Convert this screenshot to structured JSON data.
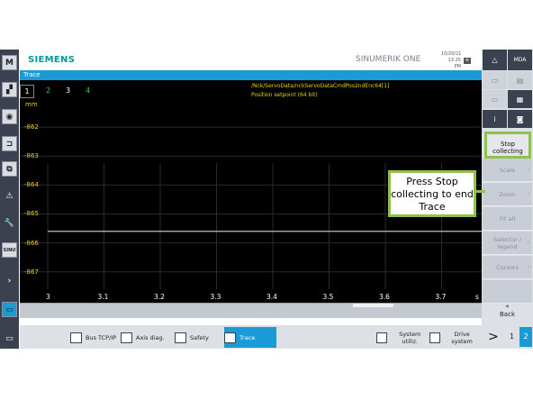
{
  "header": {
    "brand": "SIEMENS",
    "product": "SINUMERIK ONE",
    "date": "10/20/21",
    "time": "13:25 PM",
    "badge": "≡"
  },
  "window": {
    "title": "Trace"
  },
  "trace": {
    "tabs": [
      "1",
      "2",
      "3",
      "4"
    ],
    "tab_colors": [
      "#ffffff",
      "#3fc858",
      "#ffffff",
      "#3fc858"
    ],
    "unit": "mm",
    "signal_path": "/Nck/ServoData/nckServoDataCmdPos2ndEnc64[1]",
    "signal_name": "Position setpoint (64 bit)",
    "line_color": "#e8d200",
    "trace_color": "#bfbfbf"
  },
  "chart_data": {
    "type": "line",
    "x_ticks": [
      "3",
      "3.1",
      "3.2",
      "3.3",
      "3.4",
      "3.5",
      "3.6",
      "3.7"
    ],
    "x_unit": "s",
    "y_ticks": [
      "-862",
      "-863",
      "-864",
      "-865",
      "-866",
      "-867"
    ],
    "xlim": [
      3,
      3.8
    ],
    "ylim": [
      -867.6,
      -861.5
    ],
    "series": [
      {
        "x": [
          3,
          3.8
        ],
        "y": [
          -865.6,
          -865.6
        ]
      }
    ],
    "grid": true
  },
  "left_sidebar": [
    "M",
    "▞",
    "◉",
    "⊐",
    "⧉",
    "⚠",
    "🔧",
    "SINU",
    "›",
    "▭",
    "▭"
  ],
  "right_sidebar": {
    "top_left": "△",
    "top_right": "MDA",
    "stop_collecting": "Stop collecting",
    "scale": "Scale",
    "zoom": "Zoom",
    "fit_all": "Fit all",
    "selector_legend": "Selector / legend",
    "cursors": "Cursors",
    "back_icon": "«",
    "back": "Back",
    "info_icon": "i"
  },
  "bottom_bar": {
    "bus": "Bus TCP/IP",
    "axis": "Axis diag.",
    "safety": "Safety",
    "trace": "Trace",
    "system": "System utiliz.",
    "drive": "Drive system",
    "next": ">",
    "page1": "1",
    "page2": "2"
  },
  "annotation": {
    "text": "Press Stop collecting to end Trace",
    "color": "#8ec24a"
  }
}
